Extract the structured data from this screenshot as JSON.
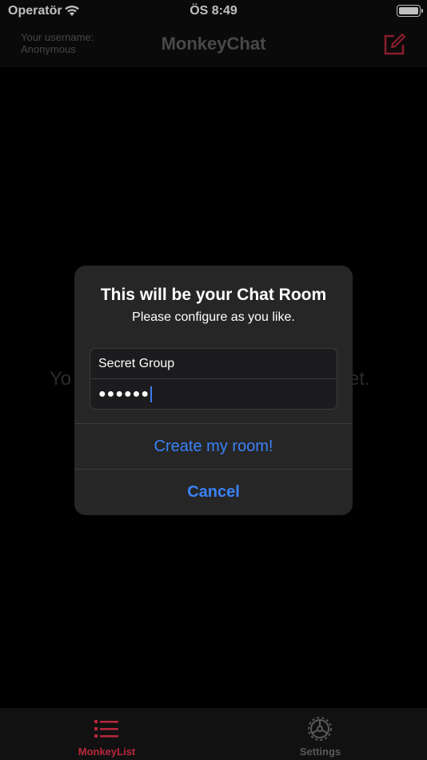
{
  "status_bar": {
    "carrier": "Operatör",
    "time": "ÖS 8:49"
  },
  "nav": {
    "username_line1": "Your username:",
    "username_line2": "Anonymous",
    "title": "MonkeyChat",
    "compose_icon": "compose-icon"
  },
  "background": {
    "hint_left": "Yo",
    "hint_right": "et."
  },
  "alert": {
    "title": "This will be your Chat Room",
    "message": "Please configure as you like.",
    "room_name_value": "Secret Group",
    "password_value": "●●●●●●",
    "create_label": "Create my room!",
    "cancel_label": "Cancel"
  },
  "tabs": [
    {
      "label": "MonkeyList",
      "icon": "list-icon",
      "selected": true
    },
    {
      "label": "Settings",
      "icon": "gear-icon",
      "selected": false
    }
  ],
  "colors": {
    "accent": "#b8273c",
    "button_blue": "#3a82f7",
    "alert_bg": "#262626"
  }
}
